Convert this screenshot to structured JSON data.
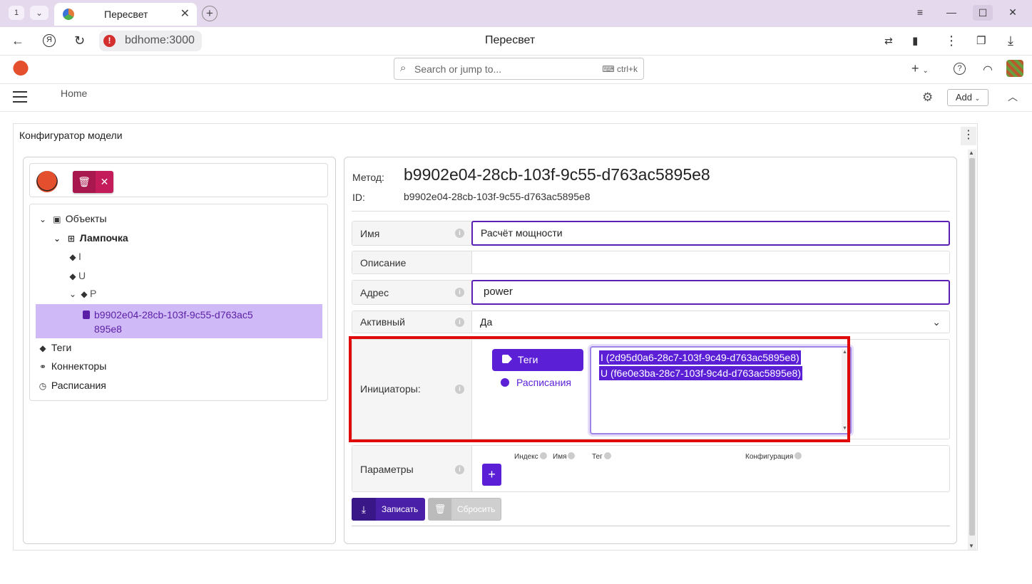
{
  "browser": {
    "tab_count": "1",
    "tab_title": "Пересвет",
    "url": "bdhome:3000",
    "window_title": "Пересвет"
  },
  "appbar": {
    "search_placeholder": "Search or jump to...",
    "search_shortcut": "ctrl+k"
  },
  "subbar": {
    "home_label": "Home",
    "add_label": "Add"
  },
  "panel": {
    "title": "Конфигуратор модели"
  },
  "tree": {
    "objects": "Объекты",
    "lamp": "Лампочка",
    "tag_i": "I",
    "tag_u": "U",
    "tag_p": "P",
    "selected_method": "b9902e04-28cb-103f-9c55-d763ac5895e8",
    "tags": "Теги",
    "connectors": "Коннекторы",
    "schedules": "Расписания"
  },
  "details": {
    "method_label": "Метод:",
    "method_value": "b9902e04-28cb-103f-9c55-d763ac5895e8",
    "id_label": "ID:",
    "id_value": "b9902e04-28cb-103f-9c55-d763ac5895e8"
  },
  "form": {
    "name_label": "Имя",
    "name_value": "Расчёт мощности",
    "desc_label": "Описание",
    "desc_value": "",
    "address_label": "Адрес",
    "address_value": "power",
    "active_label": "Активный",
    "active_value": "Да",
    "initiators_label": "Инициаторы:",
    "initiators_tab_tags": "Теги",
    "initiators_tab_schedules": "Расписания",
    "initiators_selected": [
      "I (2d95d0a6-28c7-103f-9c49-d763ac5895e8)",
      "U (f6e0e3ba-28c7-103f-9c4d-d763ac5895e8)"
    ],
    "params_label": "Параметры",
    "params_columns": {
      "index": "Индекс",
      "name": "Имя",
      "tag": "Тег",
      "config": "Конфигурация"
    },
    "save_label": "Записать",
    "reset_label": "Сбросить"
  },
  "colors": {
    "accent": "#5b1fd6",
    "highlight_frame": "#e00a0a",
    "tree_selected_bg": "#d0b9f7"
  }
}
